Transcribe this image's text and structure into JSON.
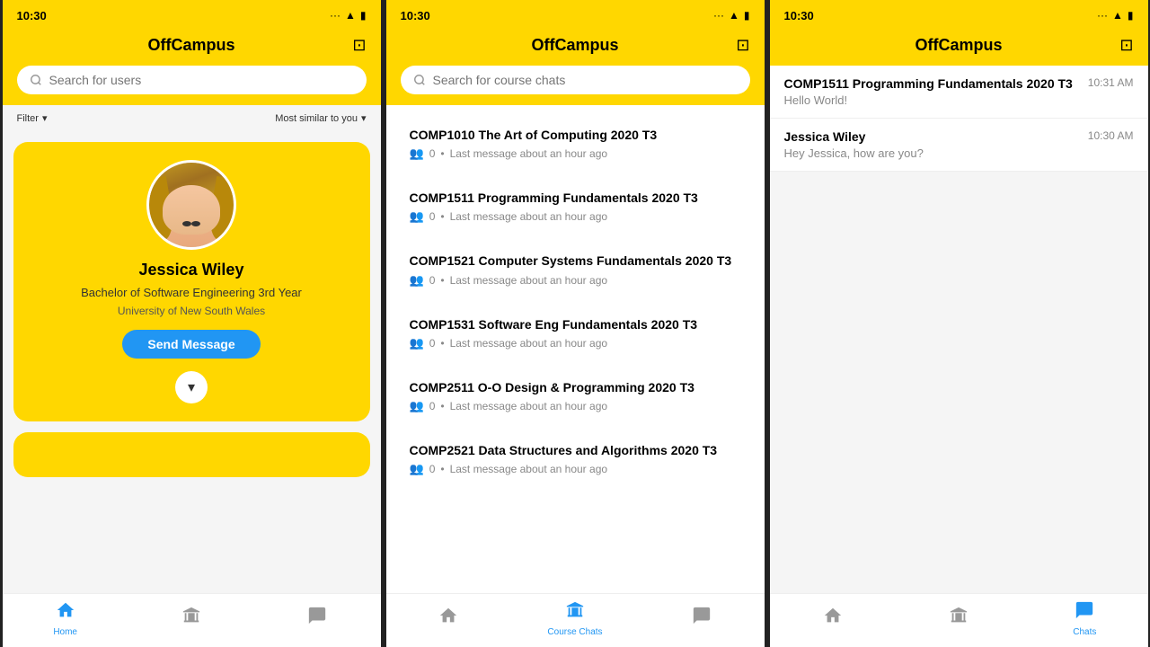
{
  "app": {
    "name": "OffCampus",
    "status_time": "10:30"
  },
  "phone1": {
    "title": "OffCampus",
    "search_placeholder": "Search for users",
    "filter_label": "Filter",
    "sort_label": "Most similar to you",
    "profile": {
      "name": "Jessica Wiley",
      "degree": "Bachelor of Software Engineering 3rd Year",
      "university": "University of New South Wales",
      "send_button": "Send Message"
    },
    "nav": {
      "home": "Home",
      "courses": "",
      "chats": ""
    }
  },
  "phone2": {
    "title": "OffCampus",
    "search_placeholder": "Search for course chats",
    "courses": [
      {
        "name": "COMP1010 The Art of Computing 2020 T3",
        "members": "0",
        "last_message": "Last message about an hour ago"
      },
      {
        "name": "COMP1511 Programming Fundamentals 2020 T3",
        "members": "0",
        "last_message": "Last message about an hour ago"
      },
      {
        "name": "COMP1521 Computer Systems Fundamentals 2020 T3",
        "members": "0",
        "last_message": "Last message about an hour ago"
      },
      {
        "name": "COMP1531 Software Eng Fundamentals 2020 T3",
        "members": "0",
        "last_message": "Last message about an hour ago"
      },
      {
        "name": "COMP2511 O-O Design & Programming 2020 T3",
        "members": "0",
        "last_message": "Last message about an hour ago"
      },
      {
        "name": "COMP2521 Data Structures and Algorithms 2020 T3",
        "members": "0",
        "last_message": "Last message about an hour ago"
      }
    ],
    "nav": {
      "home": "",
      "courses": "Course Chats",
      "chats": ""
    }
  },
  "phone3": {
    "title": "OffCampus",
    "chats": [
      {
        "name": "COMP1511 Programming Fundamentals 2020 T3",
        "time": "10:31 AM",
        "preview": "Hello World!"
      },
      {
        "name": "Jessica Wiley",
        "time": "10:30 AM",
        "preview": "Hey Jessica, how are you?"
      }
    ],
    "nav": {
      "home": "",
      "courses": "",
      "chats": "Chats"
    }
  }
}
